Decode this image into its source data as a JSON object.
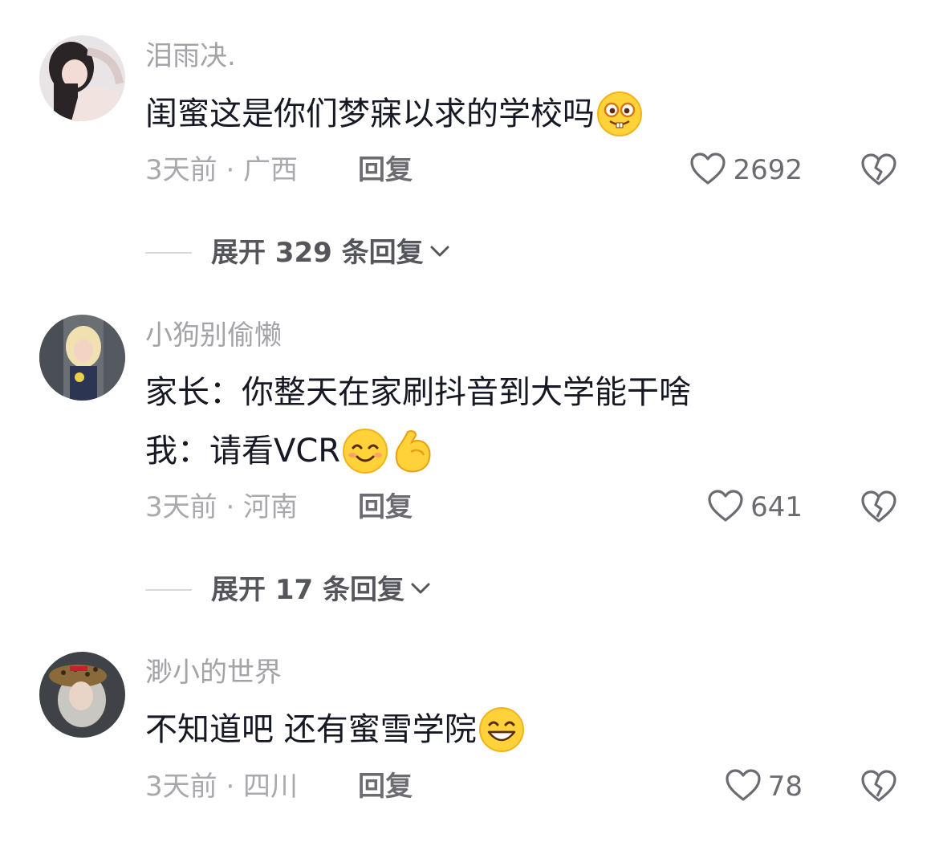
{
  "comments": [
    {
      "username": "泪雨决.",
      "lines": [
        "闺蜜这是你们梦寐以求的学校吗"
      ],
      "emojis": [
        "nerd-buck-teeth-emoji"
      ],
      "time_location": "3天前 · 广西",
      "reply_label": "回复",
      "likes": "2692",
      "expand_label": "展开 329 条回复"
    },
    {
      "username": "小狗别偷懒",
      "lines": [
        "家长：你整天在家刷抖音到大学能干啥",
        "我：请看VCR"
      ],
      "emojis": [
        "smiling-face-emoji",
        "flexed-biceps-emoji"
      ],
      "time_location": "3天前 · 河南",
      "reply_label": "回复",
      "likes": "641",
      "expand_label": "展开 17 条回复"
    },
    {
      "username": "渺小的世界",
      "lines": [
        "不知道吧 还有蜜雪学院"
      ],
      "emojis": [
        "grinning-face-emoji"
      ],
      "time_location": "3天前 · 四川",
      "reply_label": "回复",
      "likes": "78"
    }
  ],
  "colors": {
    "username": "#a3a3a8",
    "text": "#161823",
    "meta": "#a8a8ad",
    "reply": "#6b6b72",
    "icon": "#6b6b72",
    "divider": "#d9d9dc"
  }
}
